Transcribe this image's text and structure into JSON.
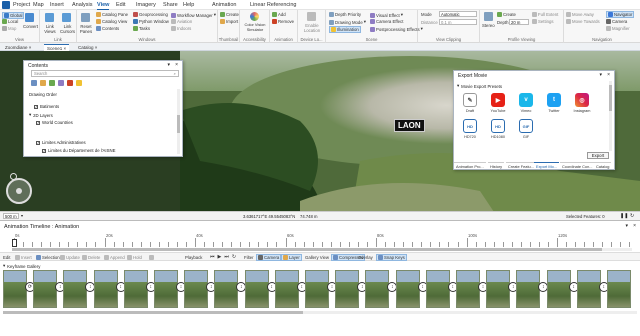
{
  "menu": {
    "tabs": [
      "Project",
      "Map",
      "Insert",
      "Analysis",
      "View",
      "Edit",
      "Imagery",
      "Share",
      "Help",
      "Animation",
      "Linear Referencing"
    ],
    "active": "View"
  },
  "ribbon": {
    "view": {
      "global": "Global",
      "local": "Local",
      "map": "Map",
      "convert": "Convert",
      "label": "View"
    },
    "link": {
      "link_views": "Link Views",
      "link_cursors": "Link Cursors",
      "label": "Link"
    },
    "windows": {
      "reset_panes": "Reset Panes",
      "catalog_pane": "Catalog Pane",
      "catalog_view": "Catalog View",
      "contents": "Contents",
      "geoprocessing": "Geoprocessing",
      "python_window": "Python Window",
      "tasks": "Tasks",
      "workflow_manager": "Workflow Manager",
      "aviation": "Aviation",
      "indoors": "Indoors",
      "label": "Windows"
    },
    "thumbnail": {
      "create": "Create",
      "import": "Import",
      "label": "Thumbnail"
    },
    "accessibility": {
      "color_vision": "Color Vision Simulator",
      "label": "Accessibility"
    },
    "animation": {
      "add": "Add",
      "remove": "Remove",
      "label": "Animation"
    },
    "device": {
      "enable_location": "Enable Location",
      "label": "Device Lo..."
    },
    "display": {
      "navigator": "Navigator",
      "pause": "Pause",
      "illumination": "Illumination",
      "label": "Display"
    },
    "scene": {
      "depth_priority": "Depth Priority",
      "drawing_mode": "Drawing Mode",
      "illumination": "Illumination",
      "visual_effect": "Visual Effect",
      "camera_effect": "Camera Effect",
      "postprocessing": "Postprocessing Effects",
      "label": "Scene"
    },
    "clipping": {
      "mode_label": "Mode",
      "mode_value": "Automatic",
      "distance_label": "Distance",
      "distance_value": "0.1 m",
      "label": "View Clipping"
    },
    "profile": {
      "stereo": "Stereo",
      "create": "Create",
      "depth_label": "Depth",
      "depth_value": "20 m",
      "full_extent": "Full Extent",
      "settings": "Settings",
      "label": "Profile Viewing"
    },
    "nav": {
      "move_away": "Move Away",
      "move_towards": "Move Towards",
      "navigator": "Navigator",
      "camera": "Camera",
      "magnifier": "Magnifier",
      "label": "Navigation"
    }
  },
  "viewtabs": [
    "Zoomdiane",
    "Scene1",
    "Catalog"
  ],
  "map": {
    "label": "LAON",
    "scale": "500 m",
    "coords": "3.6361717°E 49.5545083°N",
    "elevation": "74.748 m",
    "selected": "Selected Features: 0"
  },
  "contents": {
    "title": "Contents",
    "search_placeholder": "Search",
    "drawing_order": "Drawing Order",
    "items": [
      "Batiments",
      "2D Layers",
      "World Countries",
      "Limites Administratives",
      "Limites du Département de l'AISNE"
    ]
  },
  "export": {
    "title": "Export Movie",
    "presets_label": "Movie Export Presets",
    "presets": [
      "Draft",
      "YouTube",
      "Vimeo",
      "Twitter",
      "Instagram",
      "HD720",
      "HD1080",
      "GIF"
    ],
    "export_button": "Export",
    "tabs": [
      "Animation Pro...",
      "History",
      "Create Featu...",
      "Export Mo...",
      "Coordinate Con...",
      "Catalog"
    ]
  },
  "timeline": {
    "title": "Animation Timeline : Animation",
    "ticks": [
      "0s",
      "20s",
      "40s",
      "60s",
      "80s",
      "100s",
      "120s"
    ],
    "edit_bar": {
      "edit": "Edit",
      "insert": "Insert",
      "selection": "Selection",
      "update": "Update",
      "delete": "Delete",
      "append": "Append",
      "hold": "Hold",
      "playback": "Playback",
      "filter": "Filter",
      "camera": "Camera",
      "layer": "Layer",
      "gallery_view": "Gallery View",
      "compressed": "Compressed",
      "overlay": "Overlay",
      "snap_keys": "Snap Keys"
    },
    "gallery_label": "Keyframe Gallery",
    "keyframe_count": 21
  },
  "colors": {
    "accent": "#1a5fa8",
    "map_dark": "#2f4a25",
    "youtube": "#e62117",
    "vimeo": "#1ab7ea",
    "twitter": "#1da1f2",
    "instagram": "#c13584"
  }
}
